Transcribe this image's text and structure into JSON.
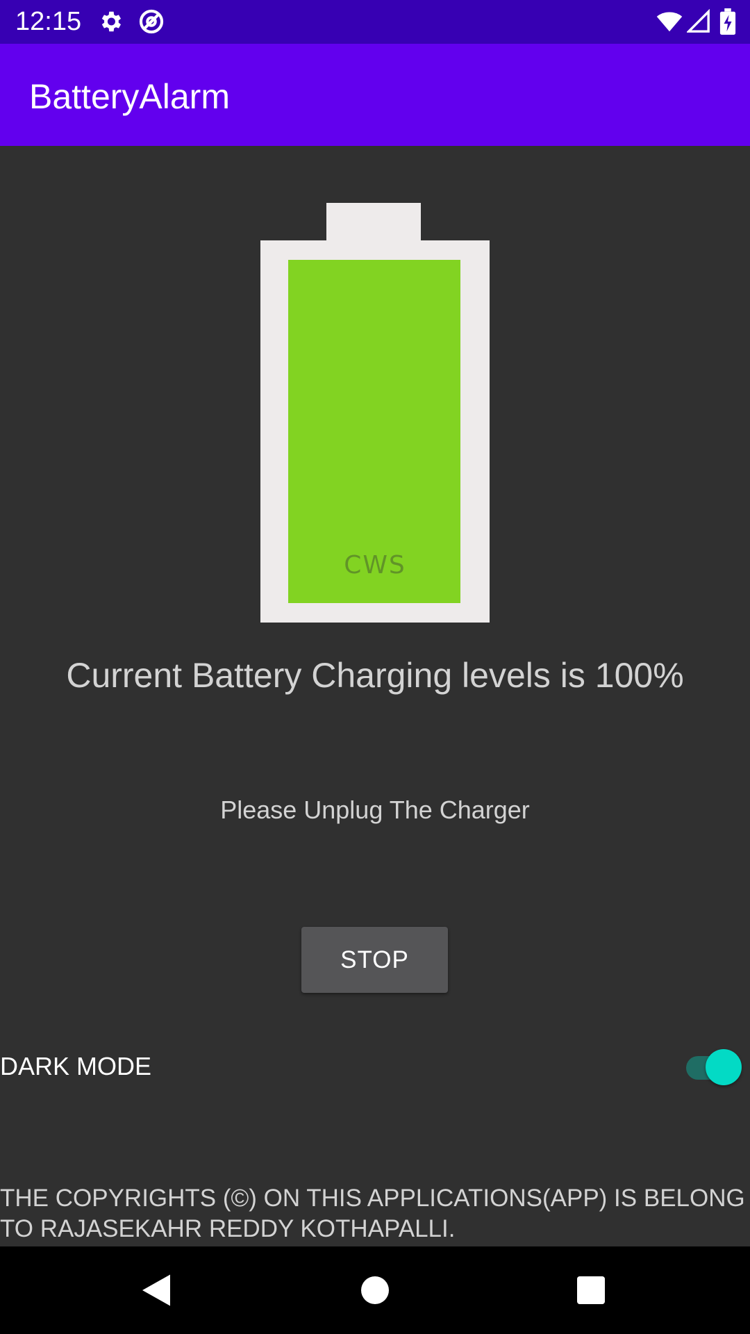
{
  "status_bar": {
    "time": "12:15",
    "icons": [
      "gear-icon",
      "at-sign-icon",
      "wifi-icon",
      "signal-icon",
      "battery-charging-icon"
    ],
    "background": "#3700B3"
  },
  "app_bar": {
    "title": "BatteryAlarm",
    "background": "#6200EE"
  },
  "battery": {
    "level_fraction": 1.0,
    "fill_color": "#82D322",
    "mark": "CWS"
  },
  "main": {
    "level_text": "Current Battery Charging levels is 100%",
    "message": "Please Unplug The Charger",
    "stop_label": "STOP"
  },
  "dark_mode": {
    "label": "DARK MODE",
    "enabled": true,
    "accent": "#03DAC5"
  },
  "footer": {
    "copyright": "THE COPYRIGHTS (©) ON THIS APPLICATIONS(APP) IS BELONG TO RAJASEKAHR REDDY KOTHAPALLI."
  },
  "nav_bar": {
    "buttons": [
      "back-icon",
      "home-icon",
      "recents-icon"
    ]
  }
}
